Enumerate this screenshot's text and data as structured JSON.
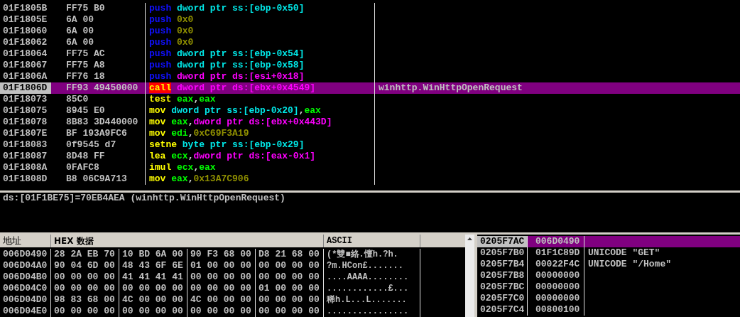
{
  "disassembly": {
    "rows": [
      {
        "address": "01F1805B",
        "bytes": "FF75 B0",
        "selected": false,
        "tokens": [
          {
            "text": "push",
            "kind": "push"
          },
          {
            "text": " dword ptr ss:[ebp-0x50]",
            "kind": "stack_mem"
          }
        ]
      },
      {
        "address": "01F1805E",
        "bytes": "6A 00",
        "selected": false,
        "tokens": [
          {
            "text": "push",
            "kind": "push"
          },
          {
            "text": " 0x0",
            "kind": "imm"
          }
        ]
      },
      {
        "address": "01F18060",
        "bytes": "6A 00",
        "selected": false,
        "tokens": [
          {
            "text": "push",
            "kind": "push"
          },
          {
            "text": " 0x0",
            "kind": "imm"
          }
        ]
      },
      {
        "address": "01F18062",
        "bytes": "6A 00",
        "selected": false,
        "tokens": [
          {
            "text": "push",
            "kind": "push"
          },
          {
            "text": " 0x0",
            "kind": "imm"
          }
        ]
      },
      {
        "address": "01F18064",
        "bytes": "FF75 AC",
        "selected": false,
        "tokens": [
          {
            "text": "push",
            "kind": "push"
          },
          {
            "text": " dword ptr ss:[ebp-0x54]",
            "kind": "stack_mem"
          }
        ]
      },
      {
        "address": "01F18067",
        "bytes": "FF75 A8",
        "selected": false,
        "tokens": [
          {
            "text": "push",
            "kind": "push"
          },
          {
            "text": " dword ptr ss:[ebp-0x58]",
            "kind": "stack_mem"
          }
        ]
      },
      {
        "address": "01F1806A",
        "bytes": "FF76 18",
        "selected": false,
        "tokens": [
          {
            "text": "push",
            "kind": "push"
          },
          {
            "text": " dword ptr ds:[esi+0x18]",
            "kind": "data_mem"
          }
        ]
      },
      {
        "address": "01F1806D",
        "bytes": "FF93 49450000",
        "selected": true,
        "tokens": [
          {
            "text": "call",
            "kind": "call"
          },
          {
            "text": " dword ptr ds:[ebx+0x4549]",
            "kind": "data_mem"
          }
        ],
        "comment": "winhttp.WinHttpOpenRequest"
      },
      {
        "address": "01F18073",
        "bytes": "85C0",
        "selected": false,
        "tokens": [
          {
            "text": "test",
            "kind": "op"
          },
          {
            "text": " eax",
            "kind": "reg"
          },
          {
            "text": ",",
            "kind": "punct"
          },
          {
            "text": "eax",
            "kind": "reg"
          }
        ]
      },
      {
        "address": "01F18075",
        "bytes": "8945 E0",
        "selected": false,
        "tokens": [
          {
            "text": "mov",
            "kind": "op"
          },
          {
            "text": " dword ptr ss:[ebp-0x20]",
            "kind": "stack_mem"
          },
          {
            "text": ",",
            "kind": "punct"
          },
          {
            "text": "eax",
            "kind": "reg"
          }
        ]
      },
      {
        "address": "01F18078",
        "bytes": "8B83 3D440000",
        "selected": false,
        "tokens": [
          {
            "text": "mov",
            "kind": "op"
          },
          {
            "text": " eax",
            "kind": "reg"
          },
          {
            "text": ",",
            "kind": "punct"
          },
          {
            "text": "dword ptr ds:[ebx+0x443D]",
            "kind": "data_mem"
          }
        ]
      },
      {
        "address": "01F1807E",
        "bytes": "BF 193A9FC6",
        "selected": false,
        "tokens": [
          {
            "text": "mov",
            "kind": "op"
          },
          {
            "text": " edi",
            "kind": "reg"
          },
          {
            "text": ",",
            "kind": "punct"
          },
          {
            "text": "0xC69F3A19",
            "kind": "imm"
          }
        ]
      },
      {
        "address": "01F18083",
        "bytes": "0f9545 d7",
        "selected": false,
        "tokens": [
          {
            "text": "setne",
            "kind": "op"
          },
          {
            "text": " byte ptr ss:[ebp-0x29]",
            "kind": "stack_mem"
          }
        ]
      },
      {
        "address": "01F18087",
        "bytes": "8D48 FF",
        "selected": false,
        "tokens": [
          {
            "text": "lea",
            "kind": "op"
          },
          {
            "text": " ecx",
            "kind": "reg"
          },
          {
            "text": ",",
            "kind": "punct"
          },
          {
            "text": "dword ptr ds:[eax-0x1]",
            "kind": "data_mem"
          }
        ]
      },
      {
        "address": "01F1808A",
        "bytes": "0FAFC8",
        "selected": false,
        "tokens": [
          {
            "text": "imul",
            "kind": "op"
          },
          {
            "text": " ecx",
            "kind": "reg"
          },
          {
            "text": ",",
            "kind": "punct"
          },
          {
            "text": "eax",
            "kind": "reg"
          }
        ]
      },
      {
        "address": "01F1808D",
        "bytes": "B8 06C9A713",
        "selected": false,
        "tokens": [
          {
            "text": "mov",
            "kind": "op"
          },
          {
            "text": " eax",
            "kind": "reg"
          },
          {
            "text": ",",
            "kind": "punct"
          },
          {
            "text": "0x13A7C906",
            "kind": "imm"
          }
        ]
      }
    ]
  },
  "info": "ds:[01F1BE75]=70EB4AEA (winhttp.WinHttpOpenRequest)",
  "dump": {
    "columns": [
      "地址",
      "HEX 数据",
      "ASCII"
    ],
    "rows": [
      {
        "address": "006D0490",
        "groups": [
          "28 2A EB 70",
          "10 BD 6A 00",
          "90 F3 68 00",
          "D8 21 68 00"
        ],
        "ascii": "(*雙■絡.憻h.?h."
      },
      {
        "address": "006D04A0",
        "groups": [
          "90 04 6D 00",
          "48 43 6F 6E",
          "01 00 00 00",
          "00 00 00 00"
        ],
        "ascii": "?m.HCon£......."
      },
      {
        "address": "006D04B0",
        "groups": [
          "00 00 00 00",
          "41 41 41 41",
          "00 00 00 00",
          "00 00 00 00"
        ],
        "ascii": "....AAAA........"
      },
      {
        "address": "006D04C0",
        "groups": [
          "00 00 00 00",
          "00 00 00 00",
          "00 00 00 00",
          "01 00 00 00"
        ],
        "ascii": "............£..."
      },
      {
        "address": "006D04D0",
        "groups": [
          "98 83 68 00",
          "4C 00 00 00",
          "4C 00 00 00",
          "00 00 00 00"
        ],
        "ascii": "稀h.L...L......."
      },
      {
        "address": "006D04E0",
        "groups": [
          "00 00 00 00",
          "00 00 00 00",
          "00 00 00 00",
          "00 00 00 00"
        ],
        "ascii": "................"
      }
    ]
  },
  "stack": {
    "rows": [
      {
        "address": "0205F7AC",
        "value": "006D0490",
        "selected": true
      },
      {
        "address": "0205F7B0",
        "value": "01F1C89D",
        "comment": "UNICODE \"GET\"",
        "selected": false
      },
      {
        "address": "0205F7B4",
        "value": "00022F4C",
        "comment": "UNICODE \"/Home\"",
        "selected": false
      },
      {
        "address": "0205F7B8",
        "value": "00000000",
        "selected": false
      },
      {
        "address": "0205F7BC",
        "value": "00000000",
        "selected": false
      },
      {
        "address": "0205F7C0",
        "value": "00000000",
        "selected": false
      },
      {
        "address": "0205F7C4",
        "value": "00800100",
        "selected": false
      }
    ]
  }
}
